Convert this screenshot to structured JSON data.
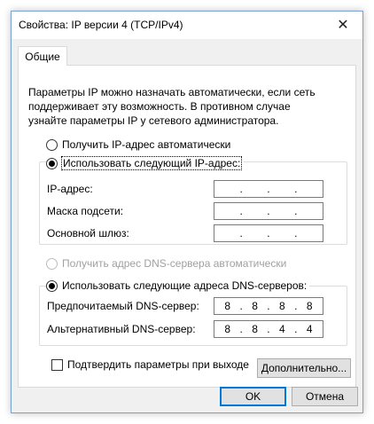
{
  "window": {
    "title": "Свойства: IP версии 4 (TCP/IPv4)",
    "close_glyph": "✕"
  },
  "tabs": [
    {
      "label": "Общие"
    }
  ],
  "intro_text": "Параметры IP можно назначать автоматически, если сеть поддерживает эту возможность. В противном случае узнайте параметры IP у сетевого администратора.",
  "ip_mode": {
    "auto_label": "Получить IP-адрес автоматически",
    "manual_label": "Использовать следующий IP-адрес:",
    "selected": "manual"
  },
  "ip_fields": [
    {
      "label": "IP-адрес:",
      "value": [
        "",
        "",
        "",
        ""
      ]
    },
    {
      "label": "Маска подсети:",
      "value": [
        "",
        "",
        "",
        ""
      ]
    },
    {
      "label": "Основной шлюз:",
      "value": [
        "",
        "",
        "",
        ""
      ]
    }
  ],
  "dns_mode": {
    "auto_label": "Получить адрес DNS-сервера автоматически",
    "manual_label": "Использовать следующие адреса DNS-серверов:",
    "selected": "manual"
  },
  "dns_fields": [
    {
      "label": "Предпочитаемый DNS-сервер:",
      "value": [
        "8",
        "8",
        "8",
        "8"
      ]
    },
    {
      "label": "Альтернативный DNS-сервер:",
      "value": [
        "8",
        "8",
        "4",
        "4"
      ]
    }
  ],
  "validate_checkbox": {
    "label": "Подтвердить параметры при выходе",
    "checked": false
  },
  "buttons": {
    "advanced": "Дополнительно...",
    "ok": "OK",
    "cancel": "Отмена"
  },
  "colors": {
    "accent": "#0078d7",
    "window_border": "#7a9fd1"
  }
}
